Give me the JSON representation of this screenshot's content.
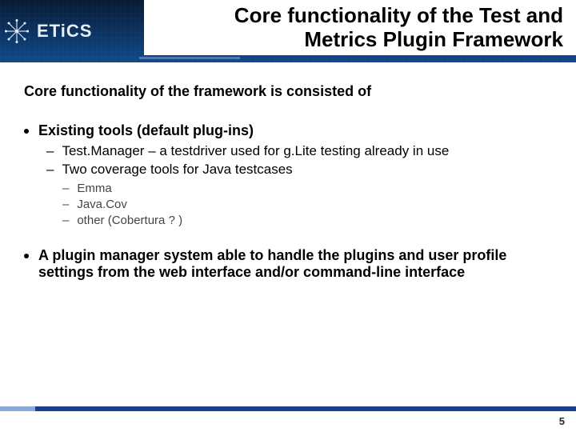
{
  "brand": {
    "name": "ETiCS"
  },
  "title": "Core functionality of the Test and Metrics Plugin Framework",
  "lead": "Core functionality of the framework is consisted of",
  "bullets": [
    {
      "text": "Existing tools (default plug-ins)",
      "children": [
        {
          "text": "Test.Manager – a testdriver used for g.Lite testing already in use"
        },
        {
          "text": "Two coverage tools for Java testcases",
          "children": [
            {
              "text": "Emma"
            },
            {
              "text": "Java.Cov"
            },
            {
              "text": "other (Cobertura ? )"
            }
          ]
        }
      ]
    },
    {
      "text": "A plugin manager system able to handle the plugins and user profile settings from the web interface and/or command-line interface"
    }
  ],
  "page_number": "5"
}
